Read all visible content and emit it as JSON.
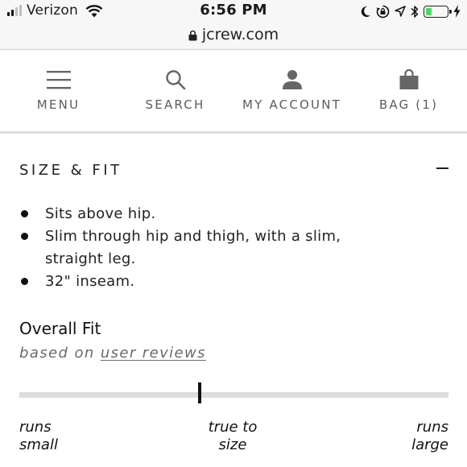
{
  "status_bar": {
    "carrier": "Verizon",
    "time": "6:56 PM",
    "signal_bars": 4,
    "signal_bars_active": 2,
    "battery_level": 0.3,
    "battery_color": "#4cd964"
  },
  "browser": {
    "url": "jcrew.com"
  },
  "nav": {
    "menu_label": "MENU",
    "search_label": "SEARCH",
    "account_label": "MY ACCOUNT",
    "bag_label": "BAG (1)",
    "icons": [
      "hamburger-icon",
      "search-icon",
      "person-icon",
      "shopping-bag-icon"
    ]
  },
  "section": {
    "title": "SIZE & FIT",
    "toggle_symbol": "minus-icon",
    "bullets": [
      "Sits above hip.",
      "Slim through hip and thigh, with a slim, straight leg.",
      "32\" inseam."
    ]
  },
  "fit": {
    "title": "Overall Fit",
    "based_on": "based on",
    "link": "user reviews",
    "marker_position": 0.42,
    "scale": {
      "left_line1": "runs",
      "left_line2": "small",
      "mid_line1": "true to",
      "mid_line2": "size",
      "right_line1": "runs",
      "right_line2": "large"
    }
  }
}
